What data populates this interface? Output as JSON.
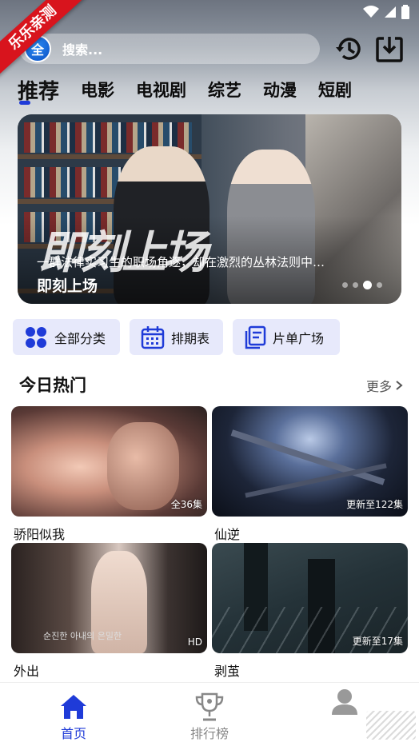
{
  "corner_ribbon": "乐乐亲测",
  "app_logo": "全",
  "search": {
    "placeholder": "搜索..."
  },
  "header_icons": [
    "history-icon",
    "download-icon"
  ],
  "tabs": [
    {
      "label": "推荐",
      "active": true
    },
    {
      "label": "电影",
      "active": false
    },
    {
      "label": "电视剧",
      "active": false
    },
    {
      "label": "综艺",
      "active": false
    },
    {
      "label": "动漫",
      "active": false
    },
    {
      "label": "短剧",
      "active": false
    }
  ],
  "banner": {
    "artwork_text": "即刻上场",
    "description": "一群法律实习生的职场角逐，却在激烈的丛林法则中…",
    "title": "即刻上场",
    "page_count": 4,
    "active_page": 3
  },
  "quick_actions": [
    {
      "label": "全部分类",
      "icon": "grid-icon"
    },
    {
      "label": "排期表",
      "icon": "calendar-icon"
    },
    {
      "label": "片单广场",
      "icon": "playlist-icon"
    }
  ],
  "section": {
    "title": "今日热门",
    "more": "更多"
  },
  "cards": [
    {
      "title": "骄阳似我",
      "badge": "全36集"
    },
    {
      "title": "仙逆",
      "badge": "更新至122集"
    },
    {
      "title": "外出",
      "badge": "HD",
      "poster_text": "순진한 아내의 은밀한"
    },
    {
      "title": "剥茧",
      "badge": "更新至17集"
    }
  ],
  "bottom_nav": [
    {
      "label": "首页",
      "icon": "home-icon",
      "active": true
    },
    {
      "label": "排行榜",
      "icon": "trophy-icon",
      "active": false
    },
    {
      "label": "",
      "icon": "user-icon",
      "active": false
    }
  ],
  "colors": {
    "accent": "#1f3bd8",
    "chip_bg": "#e7e9fb",
    "ribbon": "#d8141d"
  }
}
